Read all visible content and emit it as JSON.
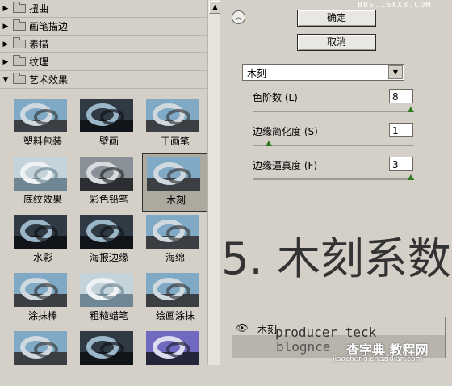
{
  "watermark_top": "BBS.16XX8.COM",
  "watermark_bottom": {
    "line1": "producer teck",
    "line2": "blognce",
    "site_cn": "查字典 教程网",
    "site_url": "jiaocheng.chazidian.com"
  },
  "categories": [
    {
      "label": "扭曲",
      "expanded": false
    },
    {
      "label": "画笔描边",
      "expanded": false
    },
    {
      "label": "素描",
      "expanded": false
    },
    {
      "label": "纹理",
      "expanded": false
    },
    {
      "label": "艺术效果",
      "expanded": true
    }
  ],
  "filters": [
    {
      "label": "塑料包装",
      "selected": false,
      "palette": "blue"
    },
    {
      "label": "壁画",
      "selected": false,
      "palette": "dark"
    },
    {
      "label": "干画笔",
      "selected": false,
      "palette": "blue"
    },
    {
      "label": "底纹效果",
      "selected": false,
      "palette": "pale"
    },
    {
      "label": "彩色铅笔",
      "selected": false,
      "palette": "gray"
    },
    {
      "label": "木刻",
      "selected": true,
      "palette": "blue"
    },
    {
      "label": "水彩",
      "selected": false,
      "palette": "dark"
    },
    {
      "label": "海报边缘",
      "selected": false,
      "palette": "dark"
    },
    {
      "label": "海绵",
      "selected": false,
      "palette": "blue"
    },
    {
      "label": "涂抹棒",
      "selected": false,
      "palette": "blue"
    },
    {
      "label": "粗糙蜡笔",
      "selected": false,
      "palette": "pale"
    },
    {
      "label": "绘画涂抹",
      "selected": false,
      "palette": "blue"
    },
    {
      "label": "",
      "selected": false,
      "palette": "blue"
    },
    {
      "label": "",
      "selected": false,
      "palette": "dark"
    },
    {
      "label": "",
      "selected": false,
      "palette": "purple"
    }
  ],
  "buttons": {
    "ok": "确定",
    "cancel": "取消"
  },
  "collapse_icon": "double-chevron-up-icon",
  "filter_select": {
    "value": "木刻"
  },
  "params": [
    {
      "label": "色阶数 (L)",
      "value": "8",
      "fraction": 1.0
    },
    {
      "label": "边缘简化度 (S)",
      "value": "1",
      "fraction": 0.1
    },
    {
      "label": "边缘逼真度 (F)",
      "value": "3",
      "fraction": 1.0
    }
  ],
  "caption": "5. 木刻系数",
  "layer": {
    "name": "木刻",
    "eye_icon": "eye-icon"
  },
  "colors": {
    "panel": "#d4d0c8",
    "slider_knob": "#2d7a1e",
    "selection": "#aea99f"
  }
}
